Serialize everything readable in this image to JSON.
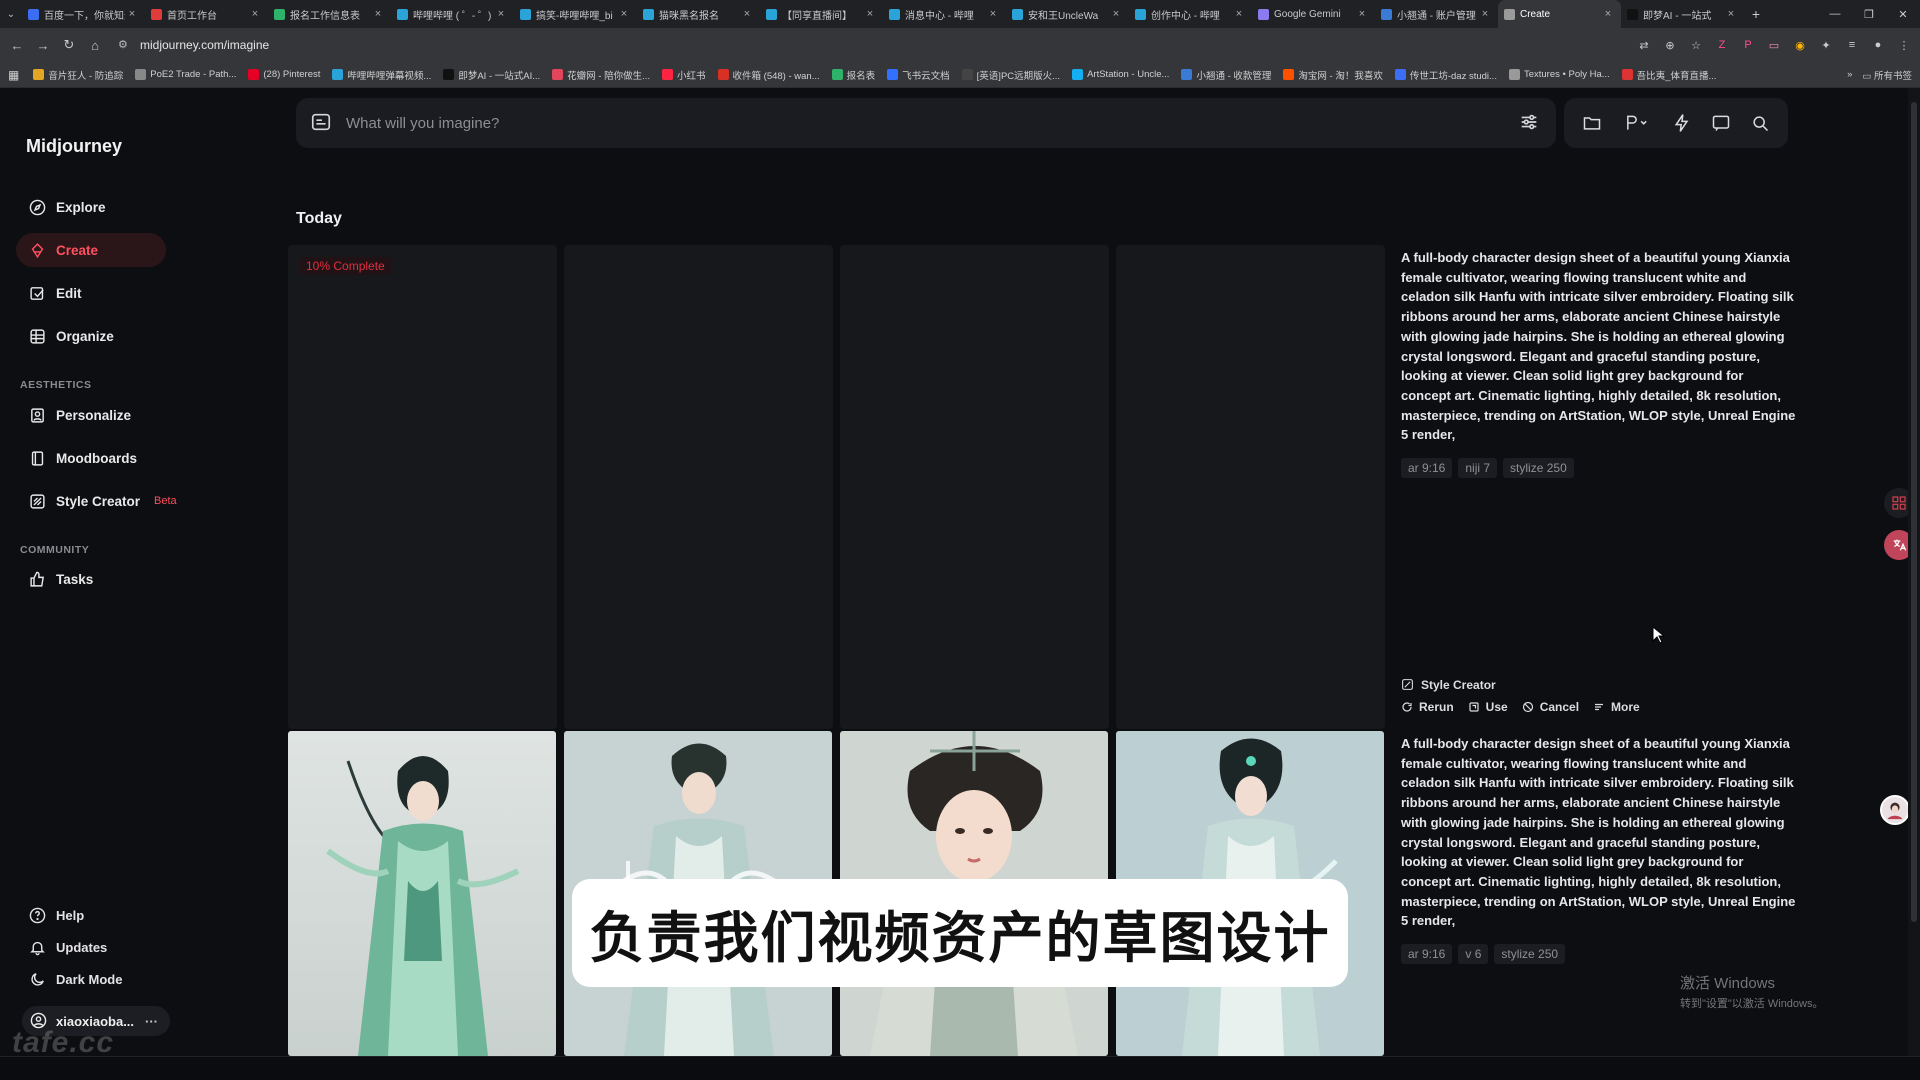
{
  "browser": {
    "tabs": [
      {
        "title": "百度一下，你就知道",
        "color": "#3b6ef5"
      },
      {
        "title": "首页工作台",
        "color": "#e03c3c"
      },
      {
        "title": "报名工作信息表",
        "color": "#2fb36a"
      },
      {
        "title": "哔哩哔哩 ( ゜- ゜)",
        "color": "#2aa4d8"
      },
      {
        "title": "搞笑-哔哩哔哩_bi",
        "color": "#2aa4d8"
      },
      {
        "title": "猫咪黑名报名",
        "color": "#2aa4d8"
      },
      {
        "title": "【同享直播间】",
        "color": "#2aa4d8"
      },
      {
        "title": "消息中心 - 哔哩",
        "color": "#2aa4d8"
      },
      {
        "title": "安和王UncleWa",
        "color": "#2aa4d8"
      },
      {
        "title": "创作中心 - 哔哩",
        "color": "#2aa4d8"
      },
      {
        "title": "Google Gemini",
        "color": "#8a7cf0"
      },
      {
        "title": "小翘通 - 账户管理",
        "color": "#3a7bd5"
      },
      {
        "title": "Create",
        "color": "#9a9a9a",
        "active": true
      },
      {
        "title": "即梦AI - 一站式",
        "color": "#111111"
      }
    ],
    "url": "midjourney.com/imagine",
    "bookmarks": [
      {
        "label": "音片狂人 - 防追踪",
        "color": "#e3a624"
      },
      {
        "label": "PoE2 Trade - Path...",
        "color": "#888888"
      },
      {
        "label": "(28) Pinterest",
        "color": "#e60023"
      },
      {
        "label": "哔哩哔哩弹幕视频...",
        "color": "#2aa4d8"
      },
      {
        "label": "即梦AI - 一站式AI...",
        "color": "#111111"
      },
      {
        "label": "花瓣网 - 陪你做生...",
        "color": "#e3455a"
      },
      {
        "label": "小红书",
        "color": "#ff2442"
      },
      {
        "label": "收件箱 (548) - wan...",
        "color": "#d93025"
      },
      {
        "label": "报名表",
        "color": "#2fb36a"
      },
      {
        "label": "飞书云文档",
        "color": "#3370ff"
      },
      {
        "label": "[英语]PC远期版火...",
        "color": "#444444"
      },
      {
        "label": "ArtStation - Uncle...",
        "color": "#13aff0"
      },
      {
        "label": "小翘通 - 收款管理",
        "color": "#3a7bd5"
      },
      {
        "label": "淘宝网 - 淘！我喜欢",
        "color": "#ff5000"
      },
      {
        "label": "传世工坊-daz studi...",
        "color": "#3b6ef5"
      },
      {
        "label": "Textures • Poly Ha...",
        "color": "#999999"
      },
      {
        "label": "吾比夷_体育直播...",
        "color": "#d33"
      }
    ],
    "bookmarks_more": "所有书签"
  },
  "sidebar": {
    "brand": "Midjourney",
    "nav": [
      {
        "label": "Explore",
        "icon": "compass-icon"
      },
      {
        "label": "Create",
        "icon": "brush-icon",
        "active": true
      },
      {
        "label": "Edit",
        "icon": "edit-icon"
      },
      {
        "label": "Organize",
        "icon": "grid-icon"
      }
    ],
    "aesthetics_label": "AESTHETICS",
    "aesthetics": [
      {
        "label": "Personalize",
        "icon": "personalize-icon"
      },
      {
        "label": "Moodboards",
        "icon": "moodboard-icon"
      },
      {
        "label": "Style Creator",
        "icon": "style-creator-icon",
        "badge": "Beta"
      }
    ],
    "community_label": "COMMUNITY",
    "community": [
      {
        "label": "Tasks",
        "icon": "thumbs-up-icon"
      }
    ],
    "footer": [
      {
        "label": "Help",
        "icon": "help-icon"
      },
      {
        "label": "Updates",
        "icon": "bell-icon"
      },
      {
        "label": "Dark Mode",
        "icon": "moon-icon"
      }
    ],
    "user": "xiaoxiaoba...",
    "watermark": "tafe.cc"
  },
  "search": {
    "placeholder": "What will you imagine?"
  },
  "main": {
    "section_title": "Today",
    "jobs": [
      {
        "progress": "10% Complete",
        "prompt": "A full-body character design sheet of a beautiful young Xianxia female cultivator, wearing flowing translucent white and celadon silk Hanfu with intricate silver embroidery. Floating silk ribbons around her arms, elaborate ancient Chinese hairstyle with glowing jade hairpins. She is holding an ethereal glowing crystal longsword. Elegant and graceful standing posture, looking at viewer. Clean solid light grey background for concept art. Cinematic lighting, highly detailed, 8k resolution, masterpiece, trending on ArtStation, WLOP style, Unreal Engine 5 render,",
        "params": [
          "ar 9:16",
          "niji 7",
          "stylize 250"
        ],
        "source": "Style Creator",
        "actions": [
          "Rerun",
          "Use",
          "Cancel",
          "More"
        ]
      },
      {
        "prompt": "A full-body character design sheet of a beautiful young Xianxia female cultivator, wearing flowing translucent white and celadon silk Hanfu with intricate silver embroidery. Floating silk ribbons around her arms, elaborate ancient Chinese hairstyle with glowing jade hairpins. She is holding an ethereal glowing crystal longsword. Elegant and graceful standing posture, looking at viewer. Clean solid light grey background for concept art. Cinematic lighting, highly detailed, 8k resolution, masterpiece, trending on ArtStation, WLOP style, Unreal Engine 5 render,",
        "params": [
          "ar 9:16",
          "v 6",
          "stylize 250"
        ]
      }
    ]
  },
  "overlay": {
    "subtitle": "负责我们视频资产的草图设计",
    "activate_title": "激活 Windows",
    "activate_sub": "转到\"设置\"以激活 Windows。"
  },
  "colors": {
    "accent": "#ff5161",
    "background": "#0d0e12",
    "panel": "#1b1c21"
  }
}
